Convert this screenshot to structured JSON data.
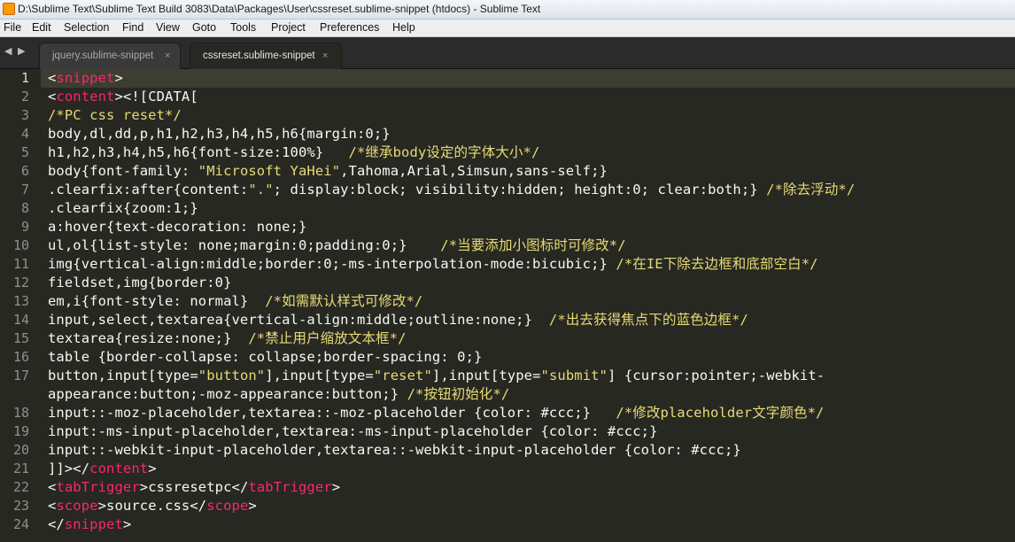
{
  "window": {
    "title": "D:\\Sublime Text\\Sublime Text Build 3083\\Data\\Packages\\User\\cssreset.sublime-snippet (htdocs) - Sublime Text",
    "icon": "sublime-text-icon"
  },
  "menu": [
    "File",
    "Edit",
    "Selection",
    "Find",
    "View",
    "Goto",
    "Tools",
    "Project",
    "Preferences",
    "Help"
  ],
  "tabs": [
    {
      "label": "jquery.sublime-snippet",
      "close": "×",
      "active": false
    },
    {
      "label": "cssreset.sublime-snippet",
      "close": "×",
      "active": true
    }
  ],
  "nav": {
    "left": "◀",
    "right": "▶"
  },
  "editor": {
    "current_line": 1,
    "line_numbers": [
      "1",
      "2",
      "3",
      "4",
      "5",
      "6",
      "7",
      "8",
      "9",
      "10",
      "11",
      "12",
      "13",
      "14",
      "15",
      "16",
      "17",
      "",
      "18",
      "19",
      "20",
      "21",
      "22",
      "23",
      "24"
    ],
    "lines": [
      "<snippet>",
      "<content><![CDATA[",
      "/*PC css reset*/",
      "body,dl,dd,p,h1,h2,h3,h4,h5,h6{margin:0;}",
      "h1,h2,h3,h4,h5,h6{font-size:100%}   /*继承body设定的字体大小*/",
      "body{font-family: \"Microsoft YaHei\",Tahoma,Arial,Simsun,sans-self;}",
      ".clearfix:after{content:\".\"; display:block; visibility:hidden; height:0; clear:both;} /*除去浮动*/",
      ".clearfix{zoom:1;}",
      "a:hover{text-decoration: none;}",
      "ul,ol{list-style: none;margin:0;padding:0;}    /*当要添加小图标时可修改*/",
      "img{vertical-align:middle;border:0;-ms-interpolation-mode:bicubic;} /*在IE下除去边框和底部空白*/",
      "fieldset,img{border:0}",
      "em,i{font-style: normal}  /*如需默认样式可修改*/",
      "input,select,textarea{vertical-align:middle;outline:none;}  /*出去获得焦点下的蓝色边框*/",
      "textarea{resize:none;}  /*禁止用户缩放文本框*/",
      "table {border-collapse: collapse;border-spacing: 0;}",
      "button,input[type=\"button\"],input[type=\"reset\"],input[type=\"submit\"] {cursor:pointer;-webkit-",
      "appearance:button;-moz-appearance:button;} /*按钮初始化*/",
      "input::-moz-placeholder,textarea::-moz-placeholder {color: #ccc;}   /*修改placeholder文字颜色*/",
      "input:-ms-input-placeholder,textarea:-ms-input-placeholder {color: #ccc;}",
      "input::-webkit-input-placeholder,textarea::-webkit-input-placeholder {color: #ccc;}",
      "]]></content>",
      "<tabTrigger>cssresetpc</tabTrigger>",
      "<scope>source.css</scope>",
      "</snippet>"
    ]
  },
  "colors": {
    "background": "#272822",
    "tag": "#f92672",
    "string": "#e6db74",
    "text": "#f8f8f2",
    "gutter": "#8f908a",
    "current_line": "#3e3d32"
  }
}
